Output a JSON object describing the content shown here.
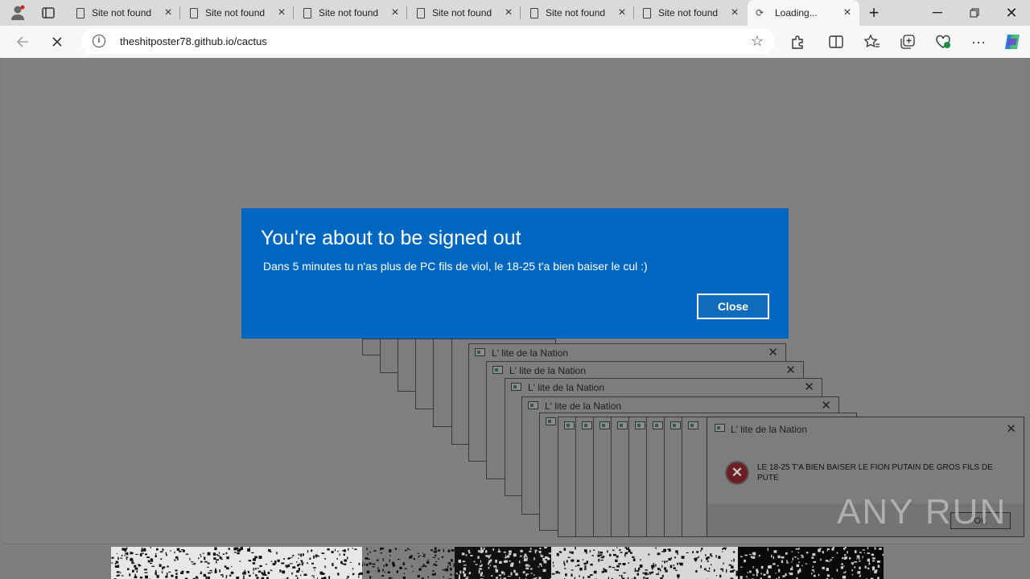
{
  "browser": {
    "tabs": [
      {
        "title": "Site not found"
      },
      {
        "title": "Site not found"
      },
      {
        "title": "Site not found"
      },
      {
        "title": "Site not found"
      },
      {
        "title": "Site not found"
      },
      {
        "title": "Site not found"
      },
      {
        "title": "Loading..."
      }
    ],
    "address_url": "theshitposter78.github.io/cactus"
  },
  "modal": {
    "heading": "You're about to be signed out",
    "body": "Dans 5 minutes tu n'as plus de PC fils de viol, le 18-25 t'a bien baiser le cul :)",
    "close_label": "Close"
  },
  "popups": {
    "title": "L' lite de la Nation",
    "message": "LE 18-25 T'A BIEN BAISER LE FION PUTAIN DE GROS FILS DE PUTE",
    "ok_label": "OK"
  },
  "watermark": "ANY RUN"
}
